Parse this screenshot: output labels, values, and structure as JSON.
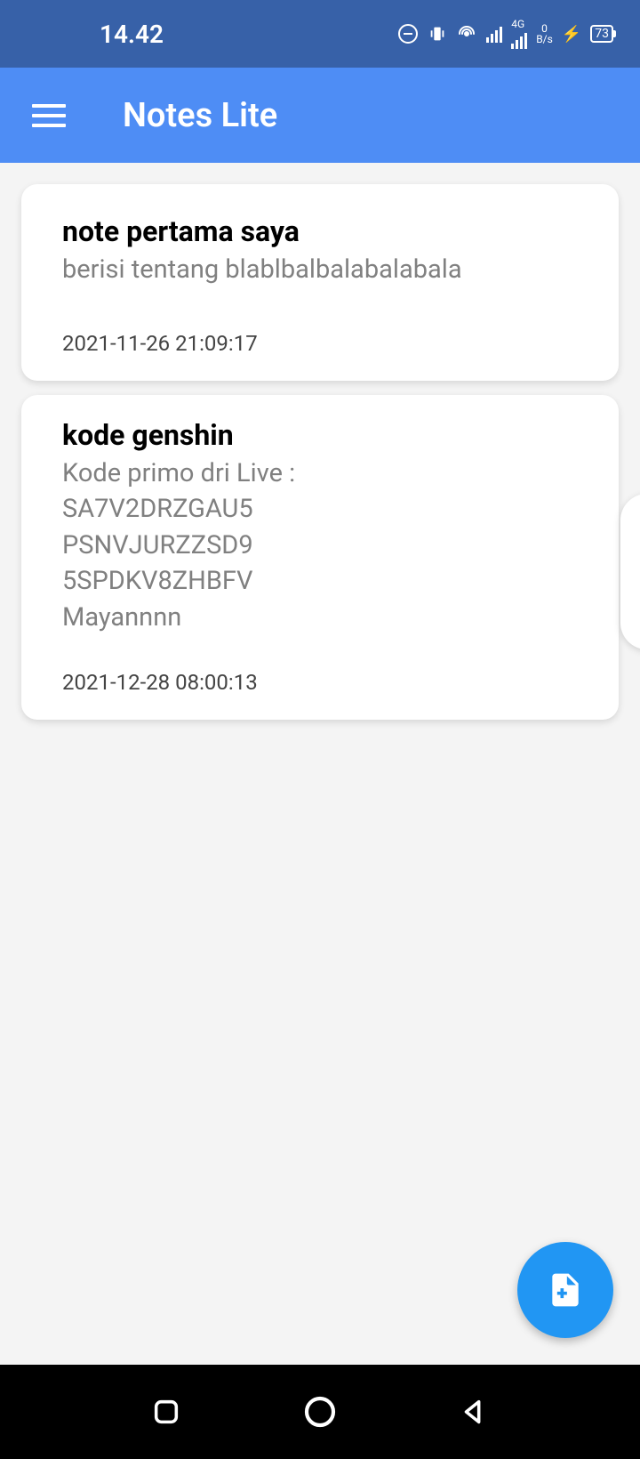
{
  "statusbar": {
    "time": "14.42",
    "network_speed": "0",
    "network_unit": "B/s",
    "network_type": "4G",
    "battery": "73"
  },
  "appbar": {
    "title": "Notes Lite",
    "menu_icon": "menu-icon"
  },
  "notes": [
    {
      "title": "note pertama saya",
      "body": "berisi tentang blablbalbalabalabala",
      "date": "2021-11-26 21:09:17"
    },
    {
      "title": "kode genshin",
      "body": "Kode primo dri Live :\nSA7V2DRZGAU5\nPSNVJURZZSD9\n5SPDKV8ZHBFV\nMayannnn",
      "date": "2021-12-28 08:00:13"
    }
  ],
  "fab": {
    "icon": "new-note-icon"
  }
}
